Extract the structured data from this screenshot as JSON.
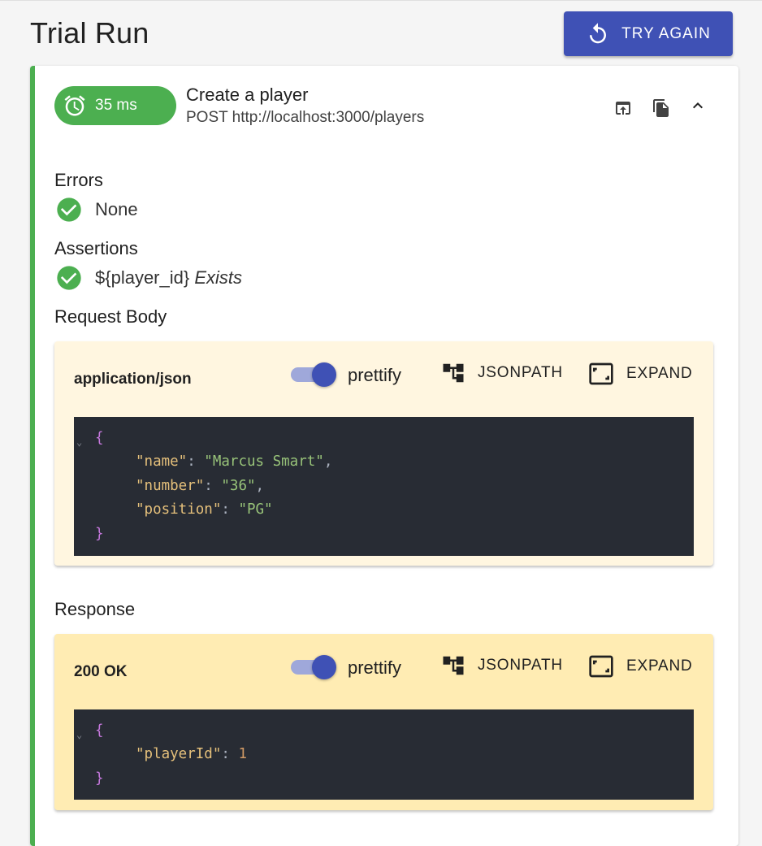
{
  "header": {
    "title": "Trial Run",
    "try_again_label": "TRY AGAIN"
  },
  "request": {
    "duration": "35 ms",
    "name": "Create a player",
    "method_url": "POST http://localhost:3000/players",
    "icons": [
      "open-in-new-icon",
      "copy-icon",
      "collapse-chevron-up-icon"
    ]
  },
  "errors": {
    "label": "Errors",
    "value": "None"
  },
  "assertions": {
    "label": "Assertions",
    "items": [
      {
        "variable": "${player_id}",
        "condition": "Exists"
      }
    ]
  },
  "request_body": {
    "label": "Request Body",
    "content_type": "application/json",
    "prettify_label": "prettify",
    "prettify_on": true,
    "jsonpath_label": "JSONPATH",
    "expand_label": "EXPAND",
    "code": {
      "open": "{",
      "close": "}",
      "fields": [
        {
          "key": "\"name\"",
          "value": "\"Marcus Smart\"",
          "trail": ","
        },
        {
          "key": "\"number\"",
          "value": "\"36\"",
          "trail": ","
        },
        {
          "key": "\"position\"",
          "value": "\"PG\"",
          "trail": ""
        }
      ]
    }
  },
  "response": {
    "label": "Response",
    "status": "200 OK",
    "prettify_label": "prettify",
    "prettify_on": true,
    "jsonpath_label": "JSONPATH",
    "expand_label": "EXPAND",
    "code": {
      "open": "{",
      "close": "}",
      "key": "\"playerId\"",
      "value": "1"
    }
  },
  "colors": {
    "accent": "#3f51b5",
    "success": "#4caf50",
    "request_panel_bg": "#fff6e0",
    "response_panel_bg": "#ffecb3",
    "code_bg": "#282c34"
  }
}
